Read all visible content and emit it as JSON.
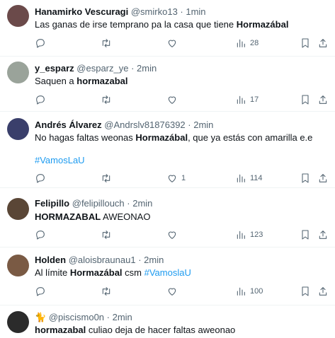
{
  "tweets": [
    {
      "name": "Hanamirko Vescuragi",
      "handle": "@smirko13",
      "time": "· 1min",
      "text_pre": "Las ganas de irse temprano pa la casa que tiene ",
      "text_bold": "Hormazábal",
      "text_post": "",
      "likes": "",
      "views": "28",
      "avatar_color": "#6b4a4a"
    },
    {
      "name": "y_esparz",
      "handle": "@esparz_ye",
      "time": "· 2min",
      "text_pre": "Saquen a ",
      "text_bold": "hormazabal",
      "text_post": "",
      "likes": "",
      "views": "17",
      "avatar_color": "#9aa39a"
    },
    {
      "name": "Andrés Álvarez",
      "handle": "@Andrslv81876392",
      "time": "· 2min",
      "text_pre": "No hagas faltas weonas ",
      "text_bold": "Hormazábal",
      "text_post": ", que ya estás con amarilla e.e",
      "hashtag": "#VamosLaU",
      "likes": "1",
      "views": "114",
      "avatar_color": "#3a3f6b"
    },
    {
      "name": "Felipillo",
      "handle": "@felipillouch",
      "time": "· 2min",
      "text_bold": "HORMAZABAL",
      "text_post": " AWEONAO",
      "likes": "",
      "views": "123",
      "avatar_color": "#5a4636"
    },
    {
      "name": "Holden",
      "handle": "@aloisbraunau1",
      "time": "· 2min",
      "text_pre": "Al límite ",
      "text_bold": "Hormazábal",
      "text_post": " csm ",
      "hashtag": "#VamoslaU",
      "likes": "",
      "views": "100",
      "avatar_color": "#7a5a44"
    },
    {
      "name": "🐈",
      "handle": "@piscismo0n",
      "time": "· 2min",
      "text_bold": "hormazabal",
      "text_post": " culiao deja de hacer faltas aweonao",
      "avatar_color": "#2b2b2b"
    }
  ],
  "colors": {
    "accent": "#1d9bf0",
    "muted": "#536471",
    "text": "#0f1419",
    "divider": "#eff3f4"
  },
  "icons": [
    "reply-icon",
    "retweet-icon",
    "like-icon",
    "views-icon",
    "bookmark-icon",
    "share-icon"
  ]
}
